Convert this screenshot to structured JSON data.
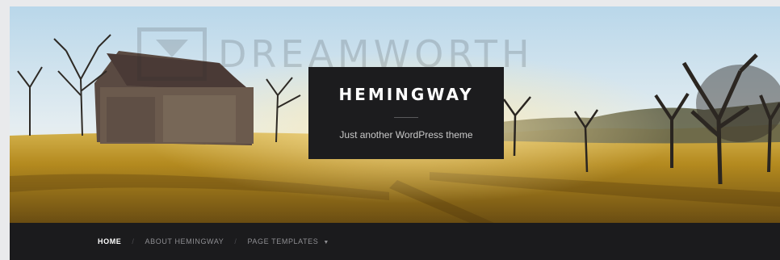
{
  "watermark": {
    "text": "DREAMWORTH"
  },
  "site": {
    "title": "HEMINGWAY",
    "description": "Just another WordPress theme"
  },
  "nav": {
    "items": [
      {
        "label": "HOME",
        "active": true
      },
      {
        "label": "ABOUT HEMINGWAY",
        "active": false
      },
      {
        "label": "PAGE TEMPLATES",
        "active": false,
        "has_dropdown": true
      }
    ],
    "separator": "/"
  },
  "colors": {
    "nav_background": "#1b1b1d",
    "title_box_background": "#1c1c1e",
    "sky": "#cfe3ee",
    "field": "#b38a22"
  },
  "icons": {
    "dropdown": "chevron-down-icon"
  }
}
